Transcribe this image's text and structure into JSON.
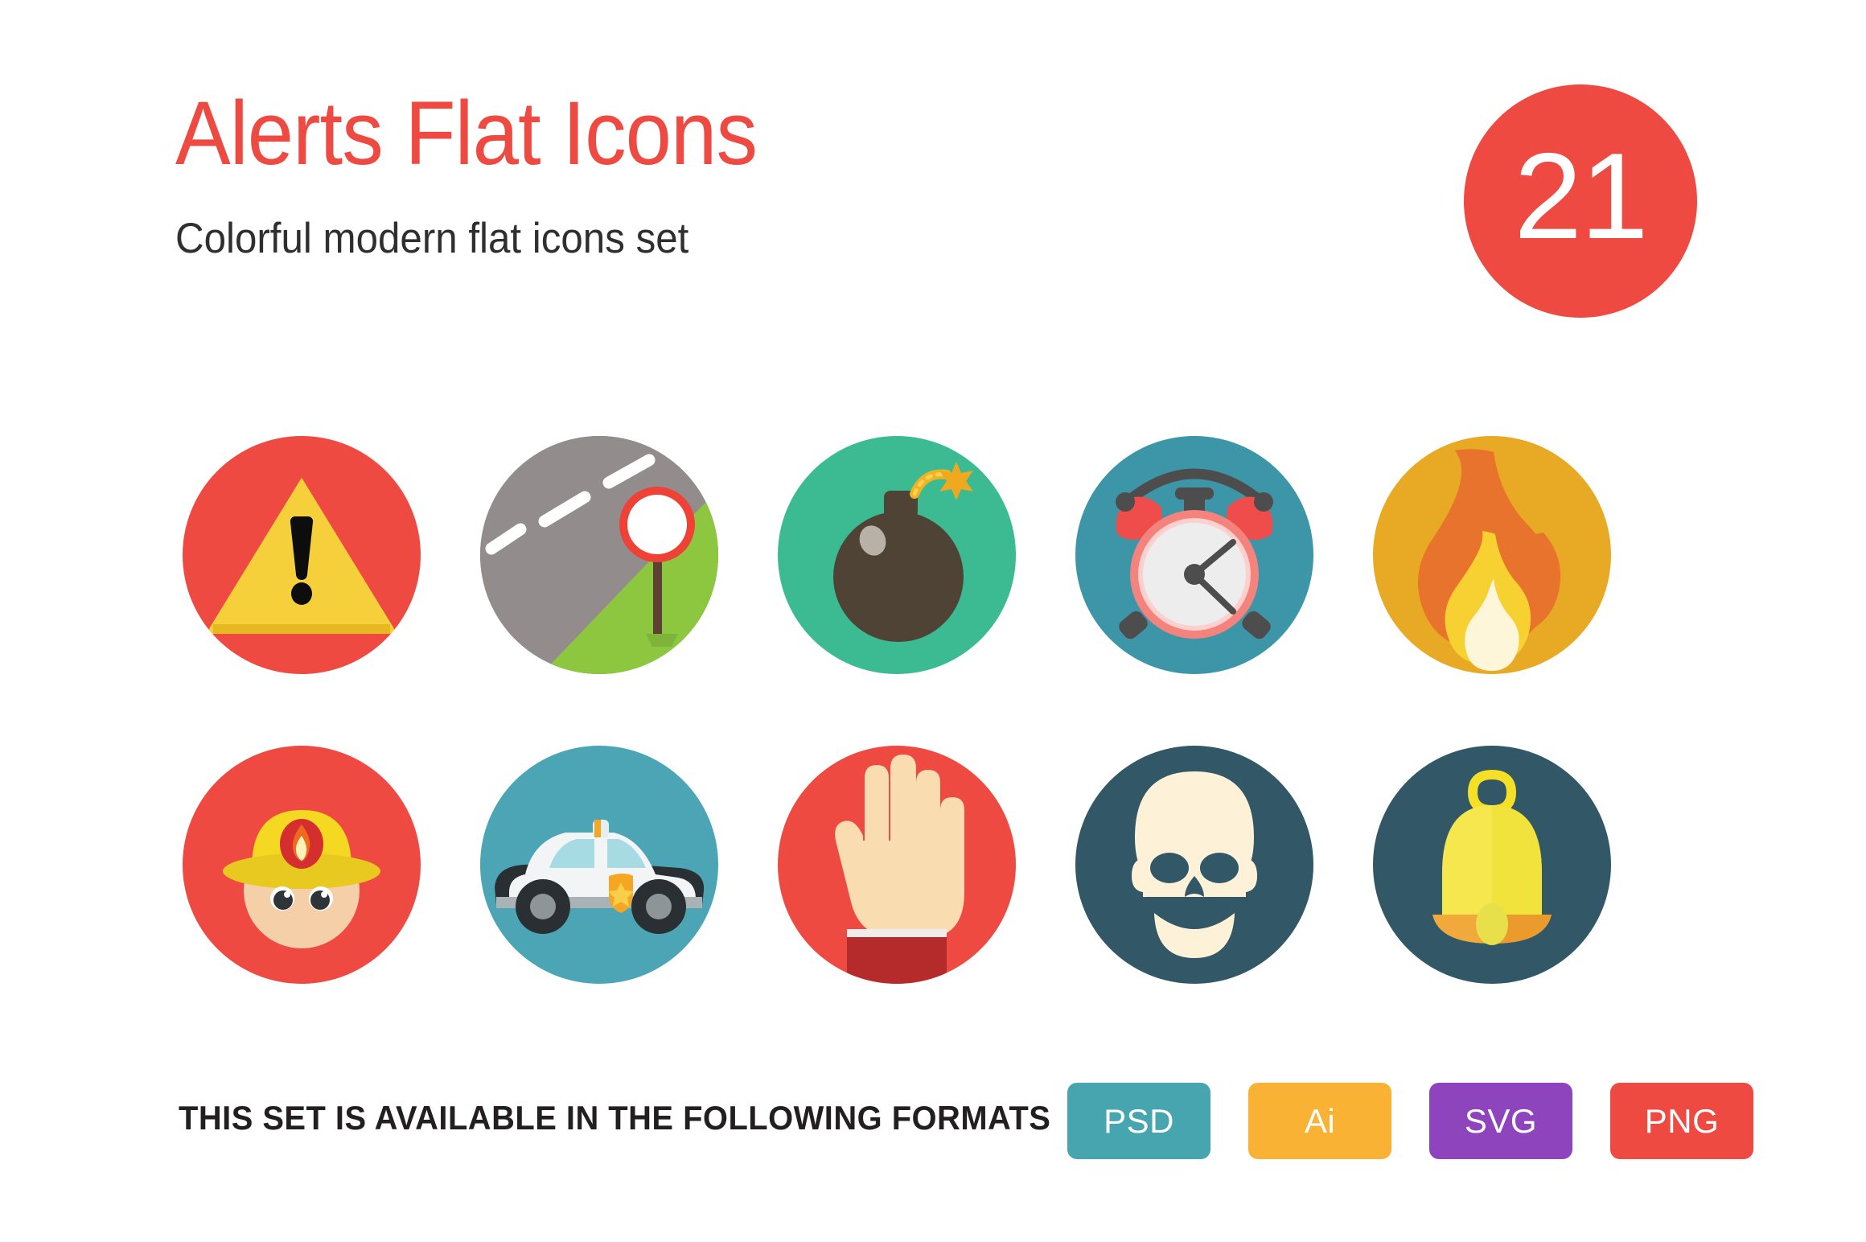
{
  "header": {
    "title": "Alerts Flat Icons",
    "subtitle": "Colorful modern flat icons  set",
    "title_color": "#ee4a42",
    "subtitle_color": "#2f2f2f",
    "count_badge": {
      "value": "21",
      "background": "#ee4a42",
      "text_color": "#ffffff"
    }
  },
  "icons": [
    {
      "name": "warning-triangle-icon",
      "label": "Warning",
      "circle_color": "#ee4a42",
      "row": 0,
      "col": 0
    },
    {
      "name": "road-sign-icon",
      "label": "Road sign",
      "circle_color": "#938c8c",
      "row": 0,
      "col": 1
    },
    {
      "name": "bomb-icon",
      "label": "Bomb",
      "circle_color": "#3cba92",
      "row": 0,
      "col": 2
    },
    {
      "name": "alarm-clock-icon",
      "label": "Alarm clock",
      "circle_color": "#3d96a8",
      "row": 0,
      "col": 3
    },
    {
      "name": "fire-flame-icon",
      "label": "Fire",
      "circle_color": "#e8a924",
      "row": 0,
      "col": 4
    },
    {
      "name": "firefighter-icon",
      "label": "Firefighter",
      "circle_color": "#ee4a42",
      "row": 1,
      "col": 0
    },
    {
      "name": "police-car-icon",
      "label": "Police car",
      "circle_color": "#4ba5b5",
      "row": 1,
      "col": 1
    },
    {
      "name": "stop-hand-icon",
      "label": "Stop hand",
      "circle_color": "#ee4a42",
      "row": 1,
      "col": 2
    },
    {
      "name": "skull-icon",
      "label": "Skull",
      "circle_color": "#325767",
      "row": 1,
      "col": 3
    },
    {
      "name": "bell-icon",
      "label": "Bell",
      "circle_color": "#325767",
      "row": 1,
      "col": 4
    }
  ],
  "footer": {
    "text": "THIS SET IS AVAILABLE IN THE FOLLOWING FORMATS",
    "formats": [
      {
        "label": "PSD",
        "color": "#46a5af"
      },
      {
        "label": "Ai",
        "color": "#f9b233"
      },
      {
        "label": "SVG",
        "color": "#8e44bd"
      },
      {
        "label": "PNG",
        "color": "#ee4a42"
      }
    ]
  }
}
